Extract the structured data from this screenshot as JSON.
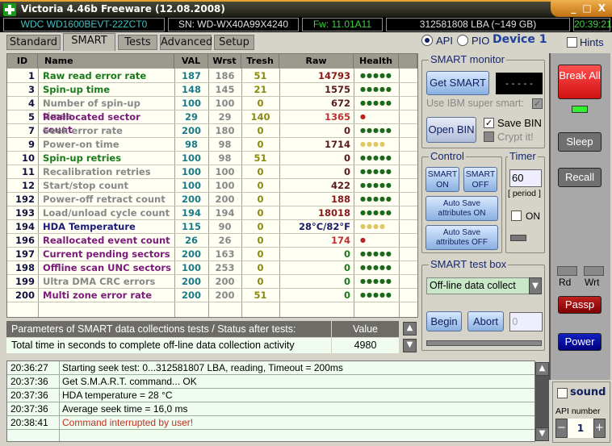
{
  "window": {
    "title": "Victoria 4.46b Freeware (12.08.2008)",
    "controls": [
      "_",
      "□",
      "X"
    ]
  },
  "info": {
    "model": "WDC WD1600BEVT-22ZCT0",
    "serial": "SN: WD-WX40A99X4240",
    "firmware": "Fw: 11.01A11",
    "lba": "312581808 LBA (~149 GB)",
    "time": "20:39:21"
  },
  "tabs": [
    {
      "label": "Standard"
    },
    {
      "label": "SMART",
      "active": true
    },
    {
      "label": "Tests"
    },
    {
      "label": "Advanced"
    },
    {
      "label": "Setup"
    }
  ],
  "mode": {
    "api": "API",
    "pio": "PIO",
    "selected": "API",
    "device": "Device 1",
    "hints": "Hints"
  },
  "table": {
    "headers": [
      "ID",
      "Name",
      "VAL",
      "Wrst",
      "Tresh",
      "Raw",
      "Health"
    ],
    "rows": [
      {
        "id": "1",
        "name": "Raw read error rate",
        "val": "187",
        "wrst": "186",
        "tresh": "51",
        "raw": "14793",
        "health": "●●●●●",
        "name_color": "#1a7a1a",
        "raw_color": "#8a1a1a",
        "health_color": "#1a6a1a"
      },
      {
        "id": "3",
        "name": "Spin-up time",
        "val": "148",
        "wrst": "145",
        "tresh": "21",
        "raw": "1575",
        "health": "●●●●●",
        "name_color": "#1a7a1a",
        "raw_color": "#5a1a1a",
        "health_color": "#1a6a1a"
      },
      {
        "id": "4",
        "name": "Number of spin-up times",
        "val": "100",
        "wrst": "100",
        "tresh": "0",
        "raw": "672",
        "health": "●●●●●",
        "name_color": "#888888",
        "raw_color": "#5a1a1a",
        "health_color": "#1a6a1a"
      },
      {
        "id": "5",
        "name": "Reallocated sector count",
        "val": "29",
        "wrst": "29",
        "tresh": "140",
        "raw": "1365",
        "health": "●",
        "name_color": "#7a1a7a",
        "raw_color": "#c03030",
        "health_color": "#c02020"
      },
      {
        "id": "7",
        "name": "Seek error rate",
        "val": "200",
        "wrst": "180",
        "tresh": "0",
        "raw": "0",
        "health": "●●●●●",
        "name_color": "#888888",
        "raw_color": "#5a1a1a",
        "health_color": "#1a6a1a"
      },
      {
        "id": "9",
        "name": "Power-on time",
        "val": "98",
        "wrst": "98",
        "tresh": "0",
        "raw": "1714",
        "health": "●●●●",
        "name_color": "#888888",
        "raw_color": "#5a1a1a",
        "health_color": "#e0c860"
      },
      {
        "id": "10",
        "name": "Spin-up retries",
        "val": "100",
        "wrst": "98",
        "tresh": "51",
        "raw": "0",
        "health": "●●●●●",
        "name_color": "#1a7a1a",
        "raw_color": "#5a1a1a",
        "health_color": "#1a6a1a"
      },
      {
        "id": "11",
        "name": "Recalibration retries",
        "val": "100",
        "wrst": "100",
        "tresh": "0",
        "raw": "0",
        "health": "●●●●●",
        "name_color": "#888888",
        "raw_color": "#5a1a1a",
        "health_color": "#1a6a1a"
      },
      {
        "id": "12",
        "name": "Start/stop count",
        "val": "100",
        "wrst": "100",
        "tresh": "0",
        "raw": "422",
        "health": "●●●●●",
        "name_color": "#888888",
        "raw_color": "#5a1a1a",
        "health_color": "#1a6a1a"
      },
      {
        "id": "192",
        "name": "Power-off retract count",
        "val": "200",
        "wrst": "200",
        "tresh": "0",
        "raw": "188",
        "health": "●●●●●",
        "name_color": "#888888",
        "raw_color": "#8a1a1a",
        "health_color": "#1a6a1a"
      },
      {
        "id": "193",
        "name": "Load/unload cycle count",
        "val": "194",
        "wrst": "194",
        "tresh": "0",
        "raw": "18018",
        "health": "●●●●●",
        "name_color": "#888888",
        "raw_color": "#8a1a1a",
        "health_color": "#1a6a1a"
      },
      {
        "id": "194",
        "name": "HDA Temperature",
        "val": "115",
        "wrst": "90",
        "tresh": "0",
        "raw": "28°C/82°F",
        "health": "●●●●",
        "name_color": "#1a1a7a",
        "raw_color": "#1a1a6a",
        "health_color": "#e0c860"
      },
      {
        "id": "196",
        "name": "Reallocated event count",
        "val": "26",
        "wrst": "26",
        "tresh": "0",
        "raw": "174",
        "health": "●",
        "name_color": "#7a1a7a",
        "raw_color": "#c03030",
        "health_color": "#c02020"
      },
      {
        "id": "197",
        "name": "Current pending sectors",
        "val": "200",
        "wrst": "163",
        "tresh": "0",
        "raw": "0",
        "health": "●●●●●",
        "name_color": "#7a1a7a",
        "raw_color": "#1a7a1a",
        "health_color": "#1a6a1a"
      },
      {
        "id": "198",
        "name": "Offline scan UNC sectors",
        "val": "100",
        "wrst": "253",
        "tresh": "0",
        "raw": "0",
        "health": "●●●●●",
        "name_color": "#7a1a7a",
        "raw_color": "#1a7a1a",
        "health_color": "#1a6a1a"
      },
      {
        "id": "199",
        "name": "Ultra DMA CRC errors",
        "val": "200",
        "wrst": "200",
        "tresh": "0",
        "raw": "0",
        "health": "●●●●●",
        "name_color": "#888888",
        "raw_color": "#1a7a1a",
        "health_color": "#1a6a1a"
      },
      {
        "id": "200",
        "name": "Multi zone error rate",
        "val": "200",
        "wrst": "200",
        "tresh": "51",
        "raw": "0",
        "health": "●●●●●",
        "name_color": "#7a1a7a",
        "raw_color": "#1a7a1a",
        "health_color": "#1a6a1a"
      }
    ]
  },
  "params": {
    "header": "Parameters of SMART data collections tests / Status after tests:",
    "value_header": "Value",
    "row_label": "Total time in seconds to complete off-line data collection activity",
    "row_value": "4980"
  },
  "monitor": {
    "legend": "SMART monitor",
    "get_smart": "Get SMART",
    "display": "- - - - -",
    "ibm": "Use IBM super smart:",
    "open_bin": "Open BIN",
    "save_bin": "Save BIN",
    "crypt": "Crypt it!"
  },
  "control": {
    "legend": "Control",
    "smart_on": "SMART ON",
    "smart_off": "SMART OFF",
    "auto_on": "Auto Save attributes ON",
    "auto_off": "Auto Save attributes OFF"
  },
  "timer": {
    "legend": "Timer",
    "value": "60",
    "period": "[ period ]",
    "on": "ON"
  },
  "testbox": {
    "legend": "SMART test box",
    "selected": "Off-line data collect",
    "begin": "Begin",
    "abort": "Abort",
    "counter": "0"
  },
  "side": {
    "break_all": "Break All",
    "sleep": "Sleep",
    "recall": "Recall",
    "rd": "Rd",
    "wrt": "Wrt",
    "passp": "Passp",
    "power": "Power",
    "sound": "sound",
    "api_number_label": "API number",
    "api_number": "1",
    "minus": "−",
    "plus": "+"
  },
  "log": [
    {
      "time": "20:36:27",
      "text": "Starting seek test: 0...312581807 LBA, reading, Timeout = 200ms",
      "color": "#000000"
    },
    {
      "time": "20:37:36",
      "text": "Get S.M.A.R.T. command... OK",
      "color": "#000000"
    },
    {
      "time": "20:37:36",
      "text": "HDA temperature = 28 °C",
      "color": "#000000"
    },
    {
      "time": "20:37:36",
      "text": "Average seek time = 16,0 ms",
      "color": "#000000"
    },
    {
      "time": "20:38:41",
      "text": "Command interrupted by user!",
      "color": "#c03020"
    }
  ]
}
